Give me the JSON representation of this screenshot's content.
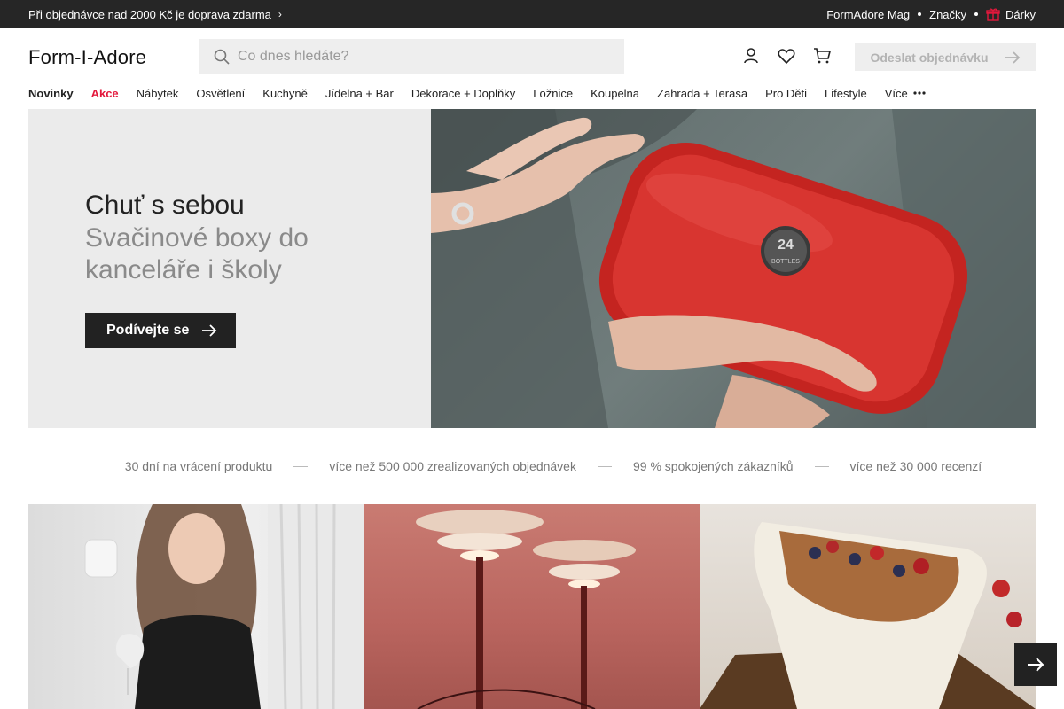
{
  "topbar": {
    "promo": "Při objednávce nad 2000 Kč je doprava zdarma",
    "links": [
      "FormAdore Mag",
      "Značky",
      "Dárky"
    ]
  },
  "header": {
    "logo": "Form-I-Adore",
    "search_placeholder": "Co dnes hledáte?",
    "order_button": "Odeslat objednávku"
  },
  "nav": {
    "items": [
      "Novinky",
      "Akce",
      "Nábytek",
      "Osvětlení",
      "Kuchyně",
      "Jídelna + Bar",
      "Dekorace + Doplňky",
      "Ložnice",
      "Koupelna",
      "Zahrada + Terasa",
      "Pro Děti",
      "Lifestyle"
    ],
    "more": "Více"
  },
  "hero": {
    "title": "Chuť s sebou",
    "subtitle": "Svačinové boxy do kanceláře i školy",
    "button": "Podívejte se",
    "badge_line1": "24",
    "badge_line2": "BOTTLES"
  },
  "stats": [
    "30 dní na vrácení produktu",
    "více než 500 000 zrealizovaných objednávek",
    "99 % spokojených zákazníků",
    "více než 30 000 recenzí"
  ],
  "colors": {
    "topbar_bg": "#262626",
    "sale": "#e3183c",
    "hero_bg": "#ebebeb",
    "box_red": "#d02a26"
  }
}
